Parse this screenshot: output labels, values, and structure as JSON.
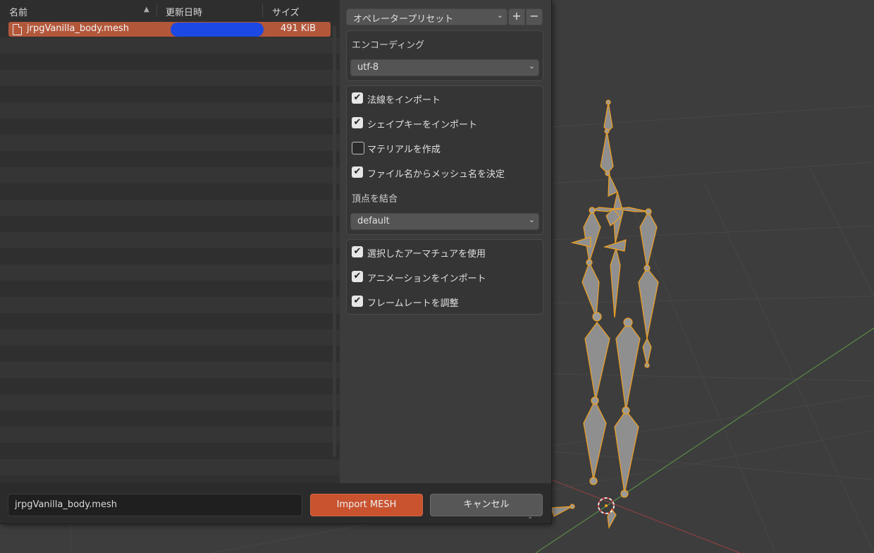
{
  "filelist": {
    "columns": {
      "name": "名前",
      "sort_indicator": "▲",
      "date": "更新日時",
      "size": "サイズ"
    },
    "files": [
      {
        "name": "jrpgVanilla_body.mesh",
        "size": "491 KiB",
        "selected": true
      }
    ]
  },
  "options": {
    "preset_label": "オペレータープリセット",
    "preset_add": "+",
    "preset_remove": "−",
    "encoding_label": "エンコーディング",
    "encoding_value": "utf-8",
    "import_normals": "法線をインポート",
    "import_shape_keys": "シェイプキーをインポート",
    "create_materials": "マテリアルを作成",
    "mesh_name_from_file": "ファイル名からメッシュ名を決定",
    "merge_vertices_label": "頂点を結合",
    "merge_vertices_value": "default",
    "use_selected_armature": "選択したアーマチュアを使用",
    "import_animation": "アニメーションをインポート",
    "adjust_framerate": "フレームレートを調整",
    "checks": {
      "import_normals": true,
      "import_shape_keys": true,
      "create_materials": false,
      "mesh_name_from_file": true,
      "use_selected_armature": true,
      "import_animation": true,
      "adjust_framerate": true
    }
  },
  "bottom": {
    "filename": "jrpgVanilla_body.mesh",
    "import_button": "Import MESH",
    "cancel_button": "キャンセル"
  },
  "colors": {
    "accent": "#c9522f",
    "selection": "#b3573b",
    "bone_outline": "#f0a020"
  }
}
